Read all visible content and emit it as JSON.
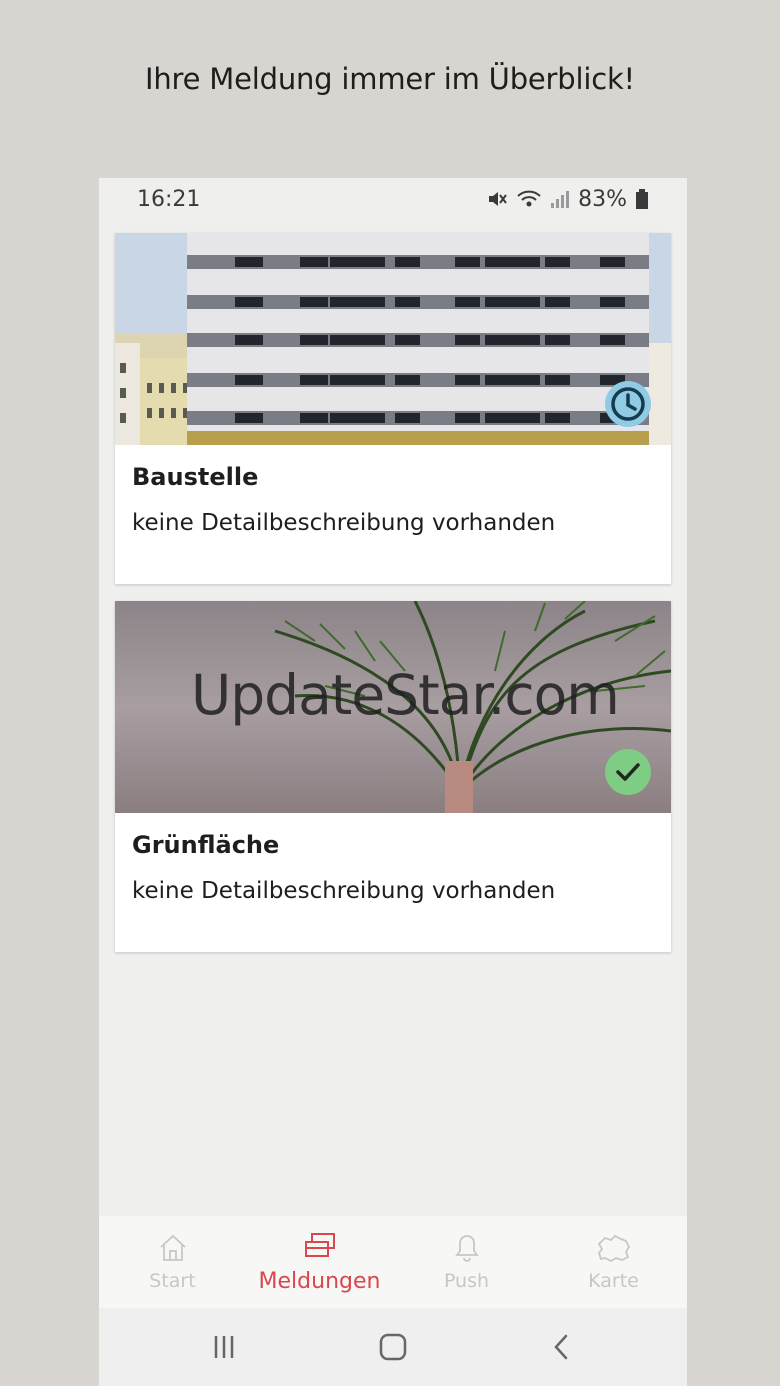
{
  "headline": "Ihre Meldung immer im Überblick!",
  "status_bar": {
    "time": "16:21",
    "battery": "83%"
  },
  "reports": [
    {
      "title": "Baustelle",
      "description": "keine Detailbeschreibung vorhanden",
      "status": "pending",
      "status_color": "#8fcbe4"
    },
    {
      "title": "Grünfläche",
      "description": "keine Detailbeschreibung vorhanden",
      "status": "done",
      "status_color": "#7fcc84",
      "watermark": "UpdateStar.com"
    }
  ],
  "bottom_nav": [
    {
      "label": "Start",
      "icon": "home-icon",
      "active": false
    },
    {
      "label": "Meldungen",
      "icon": "reports-icon",
      "active": true
    },
    {
      "label": "Push",
      "icon": "bell-icon",
      "active": false
    },
    {
      "label": "Karte",
      "icon": "map-icon",
      "active": false
    }
  ],
  "colors": {
    "accent": "#d9474e",
    "inactive": "#c7c7c7",
    "background": "#d8d4cf"
  }
}
